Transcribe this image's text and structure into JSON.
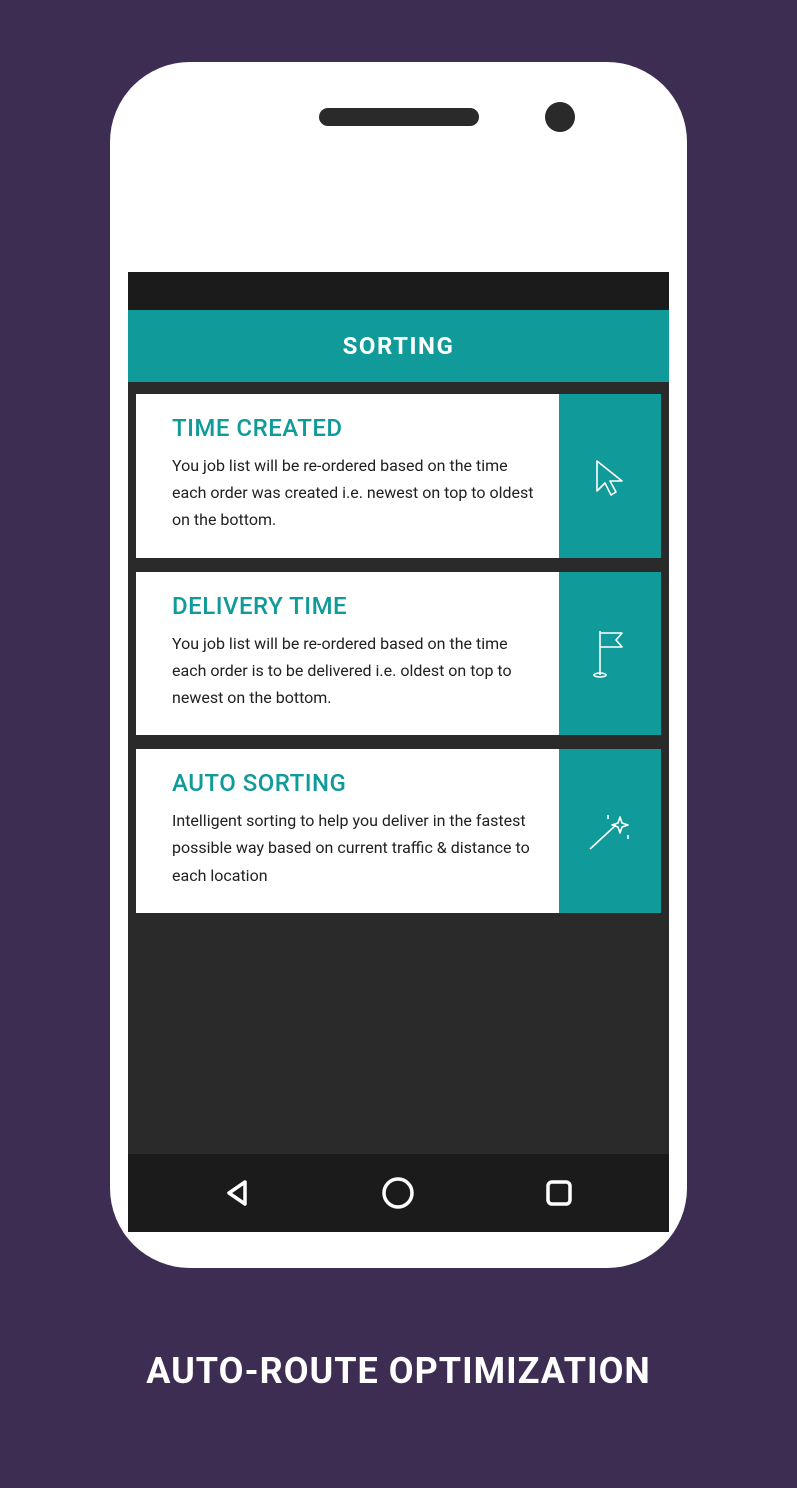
{
  "caption": "AUTO-ROUTE OPTIMIZATION",
  "header": {
    "title": "SORTING"
  },
  "options": [
    {
      "title": "TIME CREATED",
      "desc": "You job list will be re-ordered based on the time each order was created i.e. newest on top to oldest on the bottom.",
      "icon": "cursor-icon"
    },
    {
      "title": "DELIVERY TIME",
      "desc": "You job list will be re-ordered based on the time each order is to be delivered i.e. oldest on top to newest on the bottom.",
      "icon": "flag-icon"
    },
    {
      "title": "AUTO SORTING",
      "desc": "Intelligent sorting to help you deliver in the fastest possible way based on current traffic & distance to each location",
      "icon": "wand-icon"
    }
  ],
  "colors": {
    "background": "#3e2d52",
    "accent": "#109a9a",
    "dark": "#2a2a2a"
  }
}
